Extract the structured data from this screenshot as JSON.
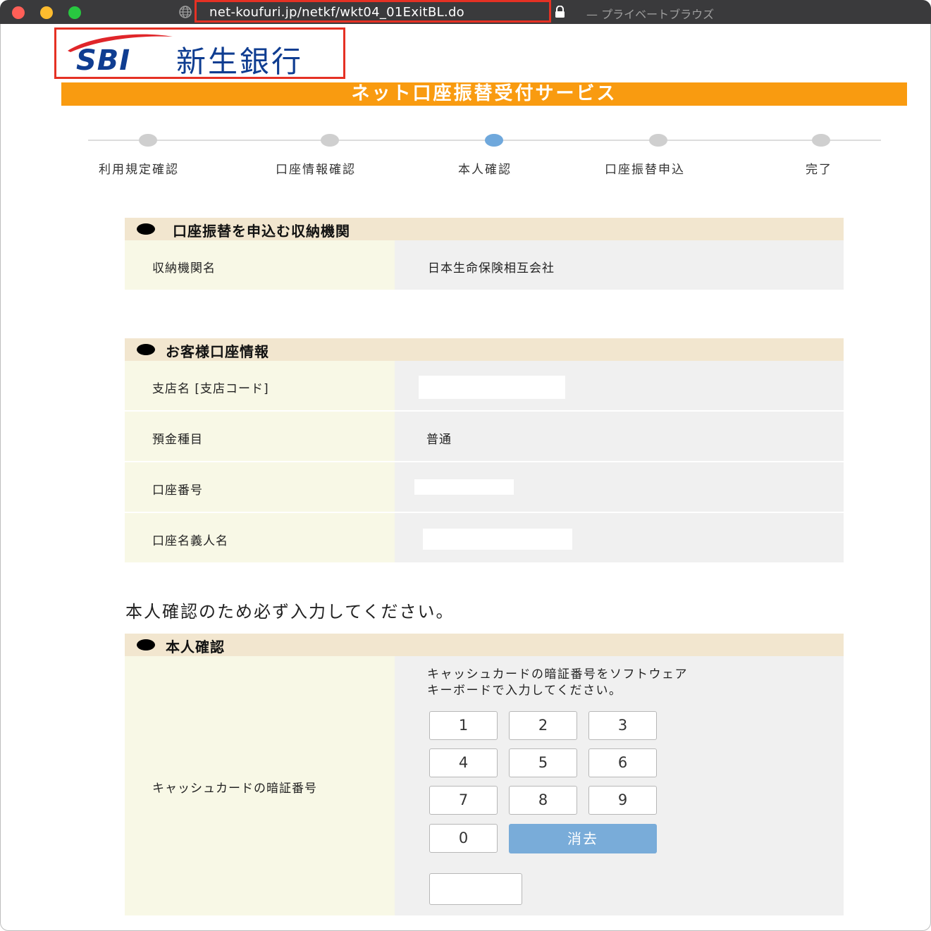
{
  "browser": {
    "url": "net-koufuri.jp/netkf/wkt04_01ExitBL.do",
    "mode_label": "— プライベートブラウズ"
  },
  "logo": {
    "brand": "SBI",
    "bank_name": "新生銀行"
  },
  "banner": {
    "title": "ネット口座振替受付サービス"
  },
  "steps": [
    {
      "label": "利用規定確認",
      "active": false
    },
    {
      "label": "口座情報確認",
      "active": false
    },
    {
      "label": "本人確認",
      "active": true
    },
    {
      "label": "口座振替申込",
      "active": false
    },
    {
      "label": "完了",
      "active": false
    }
  ],
  "section_institution": {
    "title": "口座振替を申込む収納機関",
    "label": "収納機関名",
    "value": "日本生命保険相互会社"
  },
  "section_account": {
    "title": "お客様口座情報",
    "rows": [
      {
        "label": "支店名 [支店コード]",
        "value": ""
      },
      {
        "label": "預金種目",
        "value": "普通"
      },
      {
        "label": "口座番号",
        "value": ""
      },
      {
        "label": "口座名義人名",
        "value": ""
      }
    ]
  },
  "instruction": "本人確認のため必ず入力してください。",
  "section_identity": {
    "title": "本人確認",
    "label": "キャッシュカードの暗証番号",
    "pad_instruction_line1": "キャッシュカードの暗証番号をソフトウェア",
    "pad_instruction_line2": "キーボードで入力してください。",
    "keys": [
      "1",
      "2",
      "3",
      "4",
      "5",
      "6",
      "7",
      "8",
      "9",
      "0"
    ],
    "clear_label": "消去",
    "pin_value": ""
  },
  "colors": {
    "banner": "#f99b10",
    "section_header": "#f2e6cf",
    "label_bg": "#f8f8e6",
    "value_bg": "#f0f0f0",
    "active_step": "#6fa8dc",
    "clear_button": "#79acd9",
    "highlight_box": "#e53124"
  }
}
